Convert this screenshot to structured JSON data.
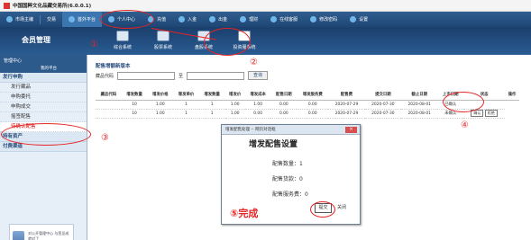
{
  "app": {
    "title": "中国国粹文化品藏交易所(6.0.0.1)"
  },
  "topnav": {
    "items": [
      "市场主编",
      "交易",
      "首外平台",
      "个人中心",
      "充值",
      "入金",
      "出金",
      "理财",
      "在线客服",
      "修改密码",
      "设置"
    ]
  },
  "banner": {
    "member_label": "会员管理",
    "module_labels": [
      "综合系统",
      "股票系统",
      "盘股系统",
      "投资服系统"
    ]
  },
  "sidebar": {
    "header": "管理中心",
    "subheader": "我的平台",
    "section1": "发行申购",
    "items": [
      "发行藏品",
      "申购委托",
      "申购成交",
      "摇签配售",
      "待确认配售"
    ],
    "section2": "持有资产",
    "section3": "付费渠道",
    "ad_text": "对公开管理中心 与您见成就对了"
  },
  "main": {
    "title": "配售增额新版本",
    "filter_label": "藏品代码",
    "to_label": "至",
    "query_label": "查询",
    "columns": [
      "藏品代码",
      "增发数量",
      "增发价格",
      "增发单价",
      "增发数量",
      "增发价",
      "增发成本",
      "配售日期",
      "增发服务费",
      "配售费",
      "提交日期",
      "截止日期",
      "上市日期",
      "状态",
      "操作"
    ],
    "rows": [
      [
        "",
        "10",
        "1.00",
        "1",
        "1",
        "1.00",
        "1.00",
        "0.00",
        "0.00",
        "2020-07-29",
        "2020-07-30",
        "2020-08-01",
        "已确认",
        ""
      ],
      [
        "",
        "10",
        "1.00",
        "1",
        "1",
        "1.00",
        "0.00",
        "0.00",
        "0.00",
        "2020-07-29",
        "2020-07-30",
        "2020-08-01",
        "未确认",
        "确认"
      ]
    ],
    "mini_confirm": "确认",
    "mini_other": "拒绝"
  },
  "dialog": {
    "title": "增发配售处理 -- 网页对话框",
    "close_label": "×",
    "heading": "增发配售设置",
    "line1": "配售数量：1",
    "line2": "配售货款：0",
    "line3": "配售服务费：0",
    "ok_label": "提交",
    "cancel_label": "关闭"
  },
  "annotations": {
    "n1": "①",
    "n2": "②",
    "n3": "③",
    "n4": "④",
    "n5": "⑤完成"
  },
  "colors": {
    "nav": "#1f4674",
    "accent": "#e52424",
    "sidebar": "#e6eef8"
  }
}
